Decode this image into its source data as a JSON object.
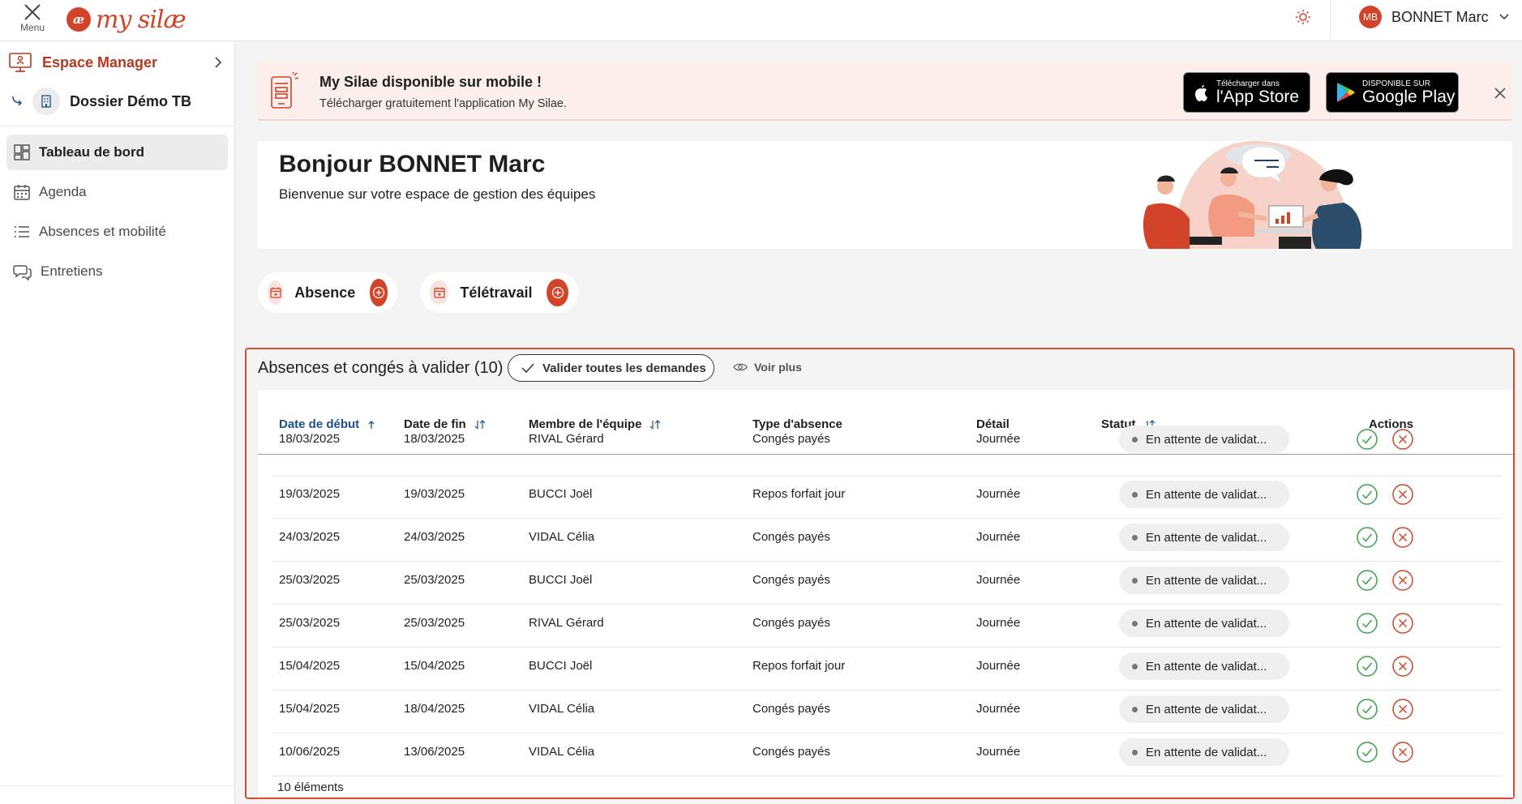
{
  "topbar": {
    "menu_label": "Menu",
    "logo_mark": "æ",
    "logo_text": "my silæ",
    "user_initials": "MB",
    "user_name": "BONNET Marc"
  },
  "sidebar": {
    "space_title": "Espace Manager",
    "dossier_title": "Dossier Démo TB",
    "items": [
      {
        "label": "Tableau de bord",
        "icon": "dashboard-icon",
        "active": true
      },
      {
        "label": "Agenda",
        "icon": "calendar-icon",
        "active": false
      },
      {
        "label": "Absences et mobilité",
        "icon": "list-icon",
        "active": false
      },
      {
        "label": "Entretiens",
        "icon": "chat-icon",
        "active": false
      }
    ]
  },
  "banner": {
    "title": "My Silae disponible sur mobile !",
    "subtitle": "Télécharger gratuitement l'application My Silae.",
    "appstore_small": "Télécharger dans",
    "appstore_big": "l'App Store",
    "googleplay_small": "DISPONIBLE SUR",
    "googleplay_big": "Google Play"
  },
  "greeting": {
    "title": "Bonjour BONNET Marc",
    "subtitle": "Bienvenue sur votre espace de gestion des équipes"
  },
  "quick_actions": {
    "absence_label": "Absence",
    "teletravail_label": "Télétravail"
  },
  "section": {
    "title": "Absences et congés à valider (10)",
    "validate_all_label": "Valider toutes les demandes",
    "voir_plus_label": "Voir plus",
    "footer_count": "10 éléments"
  },
  "table": {
    "headers": {
      "start": "Date de début",
      "end": "Date de fin",
      "member": "Membre de l'équipe",
      "type": "Type d'absence",
      "detail": "Détail",
      "status": "Statut",
      "actions": "Actions"
    },
    "rows": [
      {
        "start": "18/03/2025",
        "end": "18/03/2025",
        "member": "RIVAL Gérard",
        "type": "Congés payés",
        "detail": "Journée",
        "status": "En attente de validat..."
      },
      {
        "start": "19/03/2025",
        "end": "19/03/2025",
        "member": "BUCCI Joël",
        "type": "Repos forfait jour",
        "detail": "Journée",
        "status": "En attente de validat..."
      },
      {
        "start": "24/03/2025",
        "end": "24/03/2025",
        "member": "VIDAL Célia",
        "type": "Congés payés",
        "detail": "Journée",
        "status": "En attente de validat..."
      },
      {
        "start": "25/03/2025",
        "end": "25/03/2025",
        "member": "BUCCI Joël",
        "type": "Congés payés",
        "detail": "Journée",
        "status": "En attente de validat..."
      },
      {
        "start": "25/03/2025",
        "end": "25/03/2025",
        "member": "RIVAL Gérard",
        "type": "Congés payés",
        "detail": "Journée",
        "status": "En attente de validat..."
      },
      {
        "start": "15/04/2025",
        "end": "15/04/2025",
        "member": "BUCCI Joël",
        "type": "Repos forfait jour",
        "detail": "Journée",
        "status": "En attente de validat..."
      },
      {
        "start": "15/04/2025",
        "end": "18/04/2025",
        "member": "VIDAL Célia",
        "type": "Congés payés",
        "detail": "Journée",
        "status": "En attente de validat..."
      },
      {
        "start": "10/06/2025",
        "end": "13/06/2025",
        "member": "VIDAL Célia",
        "type": "Congés payés",
        "detail": "Journée",
        "status": "En attente de validat..."
      }
    ]
  },
  "colors": {
    "brand": "#d1442a",
    "approve": "#3aa14a",
    "reject": "#d1442a",
    "sorted_header": "#1f4f8a"
  }
}
